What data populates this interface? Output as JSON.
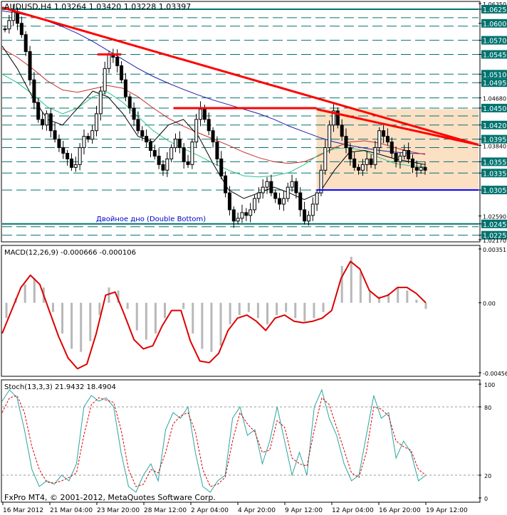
{
  "window": {
    "symbol_line": "AUDUSD,H4  1.03264  1.03420  1.03228  1.03397",
    "copyright": "FxPro MT4, © 2001-2012, MetaQuotes Software Corp."
  },
  "colors": {
    "background": "#ffffff",
    "candle": "#000000",
    "trendline": "#ff0000",
    "support": "#0000ff",
    "level_lines": "#00736f",
    "highlight_zone": "#fbe0c4",
    "ma_blue": "#1f1fa8",
    "ma_red": "#c83030",
    "ma_green": "#2ec48a",
    "ma_black": "#000000",
    "macd_line": "#dd0000",
    "macd_hist": "#b8b8b8",
    "stoch_main": "#2aa5a0",
    "stoch_signal": "#dd0000",
    "label_bg": "#00736f",
    "label_text": "#ffffff"
  },
  "chart_data": [
    {
      "type": "candlestick",
      "title": "AUDUSD,H4  1.03264  1.03420  1.03228  1.03397",
      "ylim": [
        1.0217,
        1.0635
      ],
      "annotation": "Двойное дно (Double Bottom)",
      "price_ticks": [
        "1.06350",
        "1.06250",
        "1.06000",
        "1.05700",
        "1.05450",
        "1.05100",
        "1.04950",
        "1.04680",
        "1.04500",
        "1.04200",
        "1.03840",
        "1.03950",
        "1.03550",
        "1.03350",
        "1.03050",
        "1.02590",
        "1.02450",
        "1.02250",
        "1.02170"
      ],
      "highlighted_levels": [
        "1.06250",
        "1.06000",
        "1.05700",
        "1.05450",
        "1.05100",
        "1.04950",
        "1.04500",
        "1.04200",
        "1.03950",
        "1.03550",
        "1.03350",
        "1.03050",
        "1.02450",
        "1.02250"
      ],
      "dashed_levels": [
        1.061,
        1.0595,
        1.057,
        1.0545,
        1.051,
        1.0495,
        1.0468,
        1.045,
        1.0436,
        1.042,
        1.0395,
        1.038,
        1.0355,
        1.0335,
        1.0305,
        1.024,
        1.0225
      ],
      "solid_levels": [
        1.0625,
        1.0245
      ],
      "time_labels": [
        "16 Mar 2012",
        "21 Mar 04:00",
        "23 Mar 20:00",
        "28 Mar 12:00",
        "2 Apr 04:00",
        "4 Apr 20:00",
        "9 Apr 12:00",
        "12 Apr 04:00",
        "16 Apr 20:00",
        "19 Apr 12:00"
      ],
      "closes": [
        1.059,
        1.0605,
        1.062,
        1.06,
        1.058,
        1.055,
        1.05,
        1.046,
        1.043,
        1.042,
        1.044,
        1.041,
        1.0395,
        1.038,
        1.037,
        1.036,
        1.0345,
        1.035,
        1.038,
        1.04,
        1.0395,
        1.041,
        1.044,
        1.048,
        1.052,
        1.0545,
        1.054,
        1.0525,
        1.05,
        1.047,
        1.045,
        1.043,
        1.041,
        1.04,
        1.039,
        1.0375,
        1.0365,
        1.035,
        1.034,
        1.036,
        1.038,
        1.0395,
        1.038,
        1.0355,
        1.035,
        1.039,
        1.043,
        1.0448,
        1.043,
        1.041,
        1.039,
        1.036,
        1.033,
        1.03,
        1.027,
        1.025,
        1.0255,
        1.0265,
        1.026,
        1.027,
        1.029,
        1.03,
        1.031,
        1.032,
        1.03,
        1.029,
        1.028,
        1.029,
        1.031,
        1.032,
        1.03,
        1.027,
        1.025,
        1.026,
        1.028,
        1.03,
        1.034,
        1.038,
        1.042,
        1.0445,
        1.042,
        1.04,
        1.038,
        1.036,
        1.0345,
        1.034,
        1.035,
        1.036,
        1.035,
        1.038,
        1.041,
        1.04,
        1.039,
        1.037,
        1.0355,
        1.0365,
        1.0375,
        1.036,
        1.0345,
        1.034,
        1.0345,
        1.034
      ],
      "moving_averages": [
        {
          "color": "ma_blue",
          "values": [
            1.0622,
            1.0618,
            1.0612,
            1.0604,
            1.0594,
            1.0582,
            1.0568,
            1.0552,
            1.0536,
            1.052,
            1.0506,
            1.0494,
            1.0483,
            1.0473,
            1.0464,
            1.0456,
            1.0448,
            1.044,
            1.043,
            1.0418,
            1.0408,
            1.0398,
            1.039,
            1.0384,
            1.0379,
            1.0375,
            1.0372,
            1.037,
            1.0369
          ]
        },
        {
          "color": "ma_red",
          "values": [
            1.0555,
            1.054,
            1.052,
            1.0498,
            1.0482,
            1.0478,
            1.0484,
            1.049,
            1.0485,
            1.047,
            1.045,
            1.0432,
            1.0418,
            1.0406,
            1.0395,
            1.0384,
            1.0372,
            1.0362,
            1.0355,
            1.0352,
            1.0355,
            1.0366,
            1.038,
            1.039,
            1.0392,
            1.0388,
            1.038,
            1.0373,
            1.0368
          ]
        },
        {
          "color": "ma_green",
          "values": [
            1.051,
            1.0495,
            1.0475,
            1.0452,
            1.044,
            1.045,
            1.047,
            1.0478,
            1.046,
            1.0435,
            1.041,
            1.0392,
            1.0378,
            1.0366,
            1.0352,
            1.034,
            1.033,
            1.0328,
            1.033,
            1.0336,
            1.035,
            1.0368,
            1.0378,
            1.038,
            1.0374,
            1.0362,
            1.0352,
            1.0348,
            1.0346
          ]
        },
        {
          "color": "ma_black",
          "values": [
            1.056,
            1.052,
            1.047,
            1.043,
            1.042,
            1.045,
            1.048,
            1.047,
            1.044,
            1.04,
            1.039,
            1.042,
            1.043,
            1.04,
            1.035,
            1.0305,
            1.029,
            1.03,
            1.031,
            1.03,
            1.0288,
            1.03,
            1.034,
            1.0372,
            1.0375,
            1.0368,
            1.036,
            1.0355,
            1.035
          ]
        }
      ],
      "trendlines": [
        {
          "from": [
            0,
            1.0628
          ],
          "to": [
            1,
            1.0385
          ]
        },
        {
          "from": [
            0.66,
            1.0448
          ],
          "to": [
            1,
            1.0385
          ]
        }
      ],
      "resistance_segments": [
        {
          "level": 1.0545,
          "from": 0.2,
          "to": 0.25
        },
        {
          "level": 1.045,
          "from": 0.36,
          "to": 0.66
        }
      ],
      "support_segment": {
        "level": 1.0305,
        "from": 0.66,
        "to": 1.0
      },
      "zone": {
        "from": 0.66,
        "to": 1.0,
        "top": 1.0448,
        "bottom": 1.0305
      }
    },
    {
      "type": "line",
      "title": "MACD(12,26,9) -0.000666 -0.000106",
      "ylim": [
        -0.00456,
        0.00351
      ],
      "tick_labels": [
        "0.00351",
        "0.00",
        "-0.00456"
      ],
      "tick_values": [
        0.00351,
        0.0,
        -0.00456
      ],
      "series": [
        {
          "color": "macd_line",
          "values": [
            -0.002,
            -0.0005,
            0.001,
            0.0018,
            0.0012,
            -0.0005,
            -0.0022,
            -0.0036,
            -0.0043,
            -0.004,
            -0.002,
            0.0005,
            0.0007,
            -0.0008,
            -0.0024,
            -0.003,
            -0.0028,
            -0.0015,
            -0.0005,
            -0.0005,
            -0.0025,
            -0.0038,
            -0.0039,
            -0.0033,
            -0.0018,
            -0.001,
            -0.0008,
            -0.0012,
            -0.0018,
            -0.001,
            -0.0008,
            -0.0012,
            -0.0013,
            -0.0012,
            -0.001,
            -0.0005,
            0.0016,
            0.0027,
            0.0022,
            0.0008,
            0.0003,
            0.0005,
            0.001,
            0.001,
            0.0006,
            0.0
          ]
        }
      ],
      "histogram": [
        -0.001,
        0.0003,
        0.0012,
        0.0016,
        0.001,
        -0.0006,
        -0.002,
        -0.003,
        -0.0032,
        -0.0025,
        -0.0008,
        0.001,
        0.0008,
        -0.0004,
        -0.0018,
        -0.0024,
        -0.002,
        -0.001,
        0.0,
        -0.0004,
        -0.002,
        -0.003,
        -0.0032,
        -0.0028,
        -0.0014,
        -0.0008,
        -0.0006,
        -0.001,
        -0.0014,
        -0.0008,
        -0.0006,
        -0.001,
        -0.0012,
        -0.001,
        -0.0006,
        0.0,
        0.0024,
        0.003,
        0.002,
        0.0008,
        0.0004,
        0.0006,
        0.001,
        0.0008,
        0.0002,
        -0.0004
      ]
    },
    {
      "type": "line",
      "title": "Stoch(13,3,3) 21.9432 18.4904",
      "ylim": [
        0,
        100
      ],
      "tick_labels": [
        "100",
        "80",
        "20",
        "0"
      ],
      "tick_values": [
        100,
        80,
        20,
        0
      ],
      "series": [
        {
          "color": "stoch_main",
          "values": [
            85,
            95,
            88,
            60,
            25,
            10,
            15,
            12,
            20,
            15,
            30,
            80,
            90,
            85,
            88,
            80,
            40,
            10,
            5,
            20,
            30,
            15,
            60,
            75,
            70,
            80,
            40,
            10,
            5,
            15,
            20,
            70,
            80,
            55,
            60,
            30,
            50,
            80,
            50,
            20,
            40,
            20,
            80,
            95,
            70,
            55,
            30,
            15,
            20,
            55,
            90,
            70,
            75,
            35,
            50,
            40,
            15,
            20
          ]
        },
        {
          "color": "stoch_signal",
          "values": [
            75,
            88,
            90,
            75,
            45,
            25,
            14,
            13,
            15,
            18,
            22,
            55,
            82,
            88,
            86,
            84,
            60,
            25,
            10,
            12,
            25,
            22,
            40,
            65,
            72,
            75,
            58,
            25,
            10,
            12,
            18,
            50,
            75,
            65,
            58,
            40,
            42,
            68,
            62,
            35,
            30,
            28,
            60,
            88,
            82,
            62,
            42,
            22,
            18,
            40,
            80,
            78,
            72,
            50,
            45,
            42,
            25,
            20
          ]
        }
      ]
    }
  ]
}
